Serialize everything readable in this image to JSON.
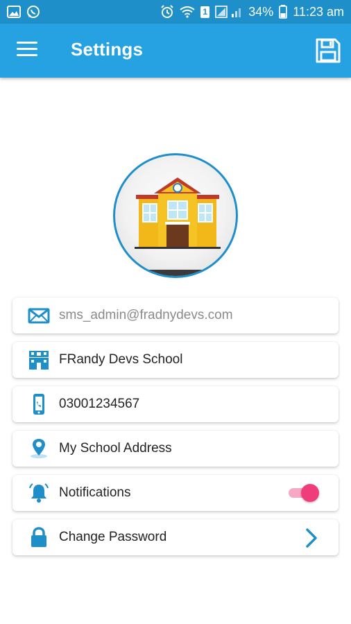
{
  "status_bar": {
    "battery": "34%",
    "time": "11:23 am",
    "sim_badge": "1",
    "left_icons": [
      "gallery-icon",
      "whatsapp-icon"
    ],
    "right_icons": [
      "alarm-icon",
      "wifi-icon",
      "sim-icon",
      "signal-icon",
      "battery-icon"
    ]
  },
  "app_bar": {
    "title": "Settings",
    "menu_icon": "menu-icon",
    "save_icon": "save-icon",
    "color": "#26a2e2"
  },
  "profile": {
    "image": "school-building-icon"
  },
  "settings": {
    "email": {
      "value": "sms_admin@fradnydevs.com",
      "icon": "email-icon"
    },
    "school_name": {
      "value": "FRandy Devs School",
      "icon": "school-icon"
    },
    "phone": {
      "value": "03001234567",
      "icon": "phone-icon"
    },
    "address": {
      "value": "My School Address",
      "icon": "location-icon"
    },
    "notifications": {
      "label": "Notifications",
      "icon": "bell-icon",
      "enabled": true
    },
    "change_password": {
      "label": "Change Password",
      "icon": "lock-icon",
      "action_icon": "chevron-right-icon"
    }
  },
  "colors": {
    "primary": "#26a2e2",
    "status_bar": "#1e8fc8",
    "accent": "#ef3d7b"
  }
}
